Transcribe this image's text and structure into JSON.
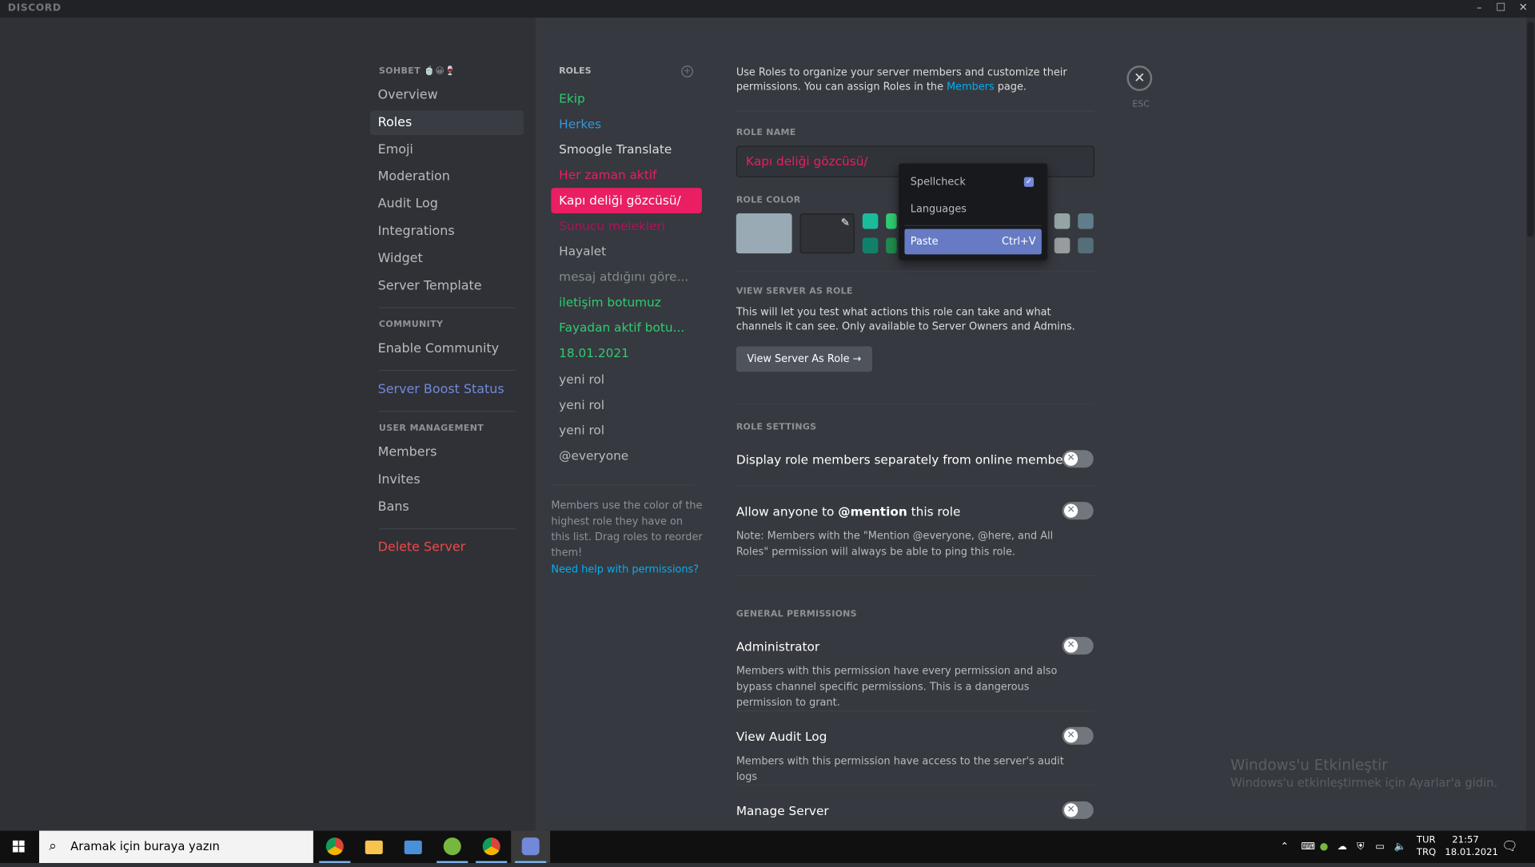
{
  "window": {
    "app_name": "DISCORD",
    "minimize": "–",
    "maximize": "☐",
    "close": "✕"
  },
  "sidebar": {
    "server_header": "SOHBET 🍵😀🍷",
    "items": [
      {
        "label": "Overview",
        "active": false
      },
      {
        "label": "Roles",
        "active": true
      },
      {
        "label": "Emoji",
        "active": false
      },
      {
        "label": "Moderation",
        "active": false
      },
      {
        "label": "Audit Log",
        "active": false
      },
      {
        "label": "Integrations",
        "active": false
      },
      {
        "label": "Widget",
        "active": false
      },
      {
        "label": "Server Template",
        "active": false
      }
    ],
    "community_header": "COMMUNITY",
    "enable_community": "Enable Community",
    "boost_status": "Server Boost Status",
    "user_mgmt_header": "USER MANAGEMENT",
    "user_items": [
      "Members",
      "Invites",
      "Bans"
    ],
    "delete_server": "Delete Server"
  },
  "roles": {
    "header": "ROLES",
    "add_icon": "plus-circle-icon",
    "list": [
      {
        "name": "Ekip",
        "color": "#2ecc71"
      },
      {
        "name": "Herkes",
        "color": "#3498db"
      },
      {
        "name": "Smoogle Translate",
        "color": "#dcddde"
      },
      {
        "name": "Her zaman aktif",
        "color": "#e91e63"
      },
      {
        "name": "Kapı deliği gözcüsü/",
        "color": "#ffffff",
        "active": true
      },
      {
        "name": "Sunucu melekleri",
        "color": "#ad1457"
      },
      {
        "name": "Hayalet",
        "color": "#b9bbbe"
      },
      {
        "name": "mesaj atdığını göre...",
        "color": "#7f8c8d"
      },
      {
        "name": "iletişim botumuz",
        "color": "#2ecc71"
      },
      {
        "name": "Fayadan aktif botu...",
        "color": "#2ecc71"
      },
      {
        "name": "18.01.2021",
        "color": "#2ecc71"
      },
      {
        "name": "yeni rol",
        "color": "#b9bbbe"
      },
      {
        "name": "yeni rol",
        "color": "#b9bbbe"
      },
      {
        "name": "yeni rol",
        "color": "#b9bbbe"
      },
      {
        "name": "@everyone",
        "color": "#b9bbbe"
      }
    ],
    "note": "Members use the color of the highest role they have on this list. Drag roles to reorder them!",
    "help_link": "Need help with permissions?"
  },
  "main": {
    "intro_prefix": "Use Roles to organize your server members and customize their permissions. You can assign Roles in the ",
    "intro_link": "Members",
    "intro_suffix": " page.",
    "role_name_label": "ROLE NAME",
    "role_name_value": "Kapı deliği gözcüsü/",
    "role_color_label": "ROLE COLOR",
    "swatches_row1": [
      "#1abc9c",
      "#2ecc71",
      "#95a5a6",
      "#607d8b"
    ],
    "swatches_row2": [
      "#11806a",
      "#1f8b4c",
      "#979c9f",
      "#546e7a"
    ],
    "view_as_role_label": "VIEW SERVER AS ROLE",
    "view_as_role_desc": "This will let you test what actions this role can take and what channels it can see. Only available to Server Owners and Admins.",
    "view_as_role_button": "View Server As Role →",
    "role_settings_label": "ROLE SETTINGS",
    "display_separately": "Display role members separately from online members",
    "mention_prefix": "Allow anyone to ",
    "mention_bold": "@mention",
    "mention_suffix": " this role",
    "mention_note": "Note: Members with the \"Mention @everyone, @here, and All Roles\" permission will always be able to ping this role.",
    "general_permissions_label": "GENERAL PERMISSIONS",
    "administrator": "Administrator",
    "administrator_desc": "Members with this permission have every permission and also bypass channel specific permissions. This is a dangerous permission to grant.",
    "view_audit_log": "View Audit Log",
    "view_audit_log_desc": "Members with this permission have access to the server's audit logs",
    "manage_server": "Manage Server",
    "close_label": "ESC"
  },
  "context_menu": {
    "spellcheck": "Spellcheck",
    "spellcheck_checked": true,
    "languages": "Languages",
    "paste": "Paste",
    "paste_shortcut": "Ctrl+V"
  },
  "watermark": {
    "line1": "Windows'u Etkinleştir",
    "line2": "Windows'u etkinleştirmek için Ayarlar'a gidin."
  },
  "taskbar": {
    "search_placeholder": "Aramak için buraya yazın",
    "lang_line1": "TUR",
    "lang_line2": "TRQ",
    "time": "21:57",
    "date": "18.01.2021"
  }
}
